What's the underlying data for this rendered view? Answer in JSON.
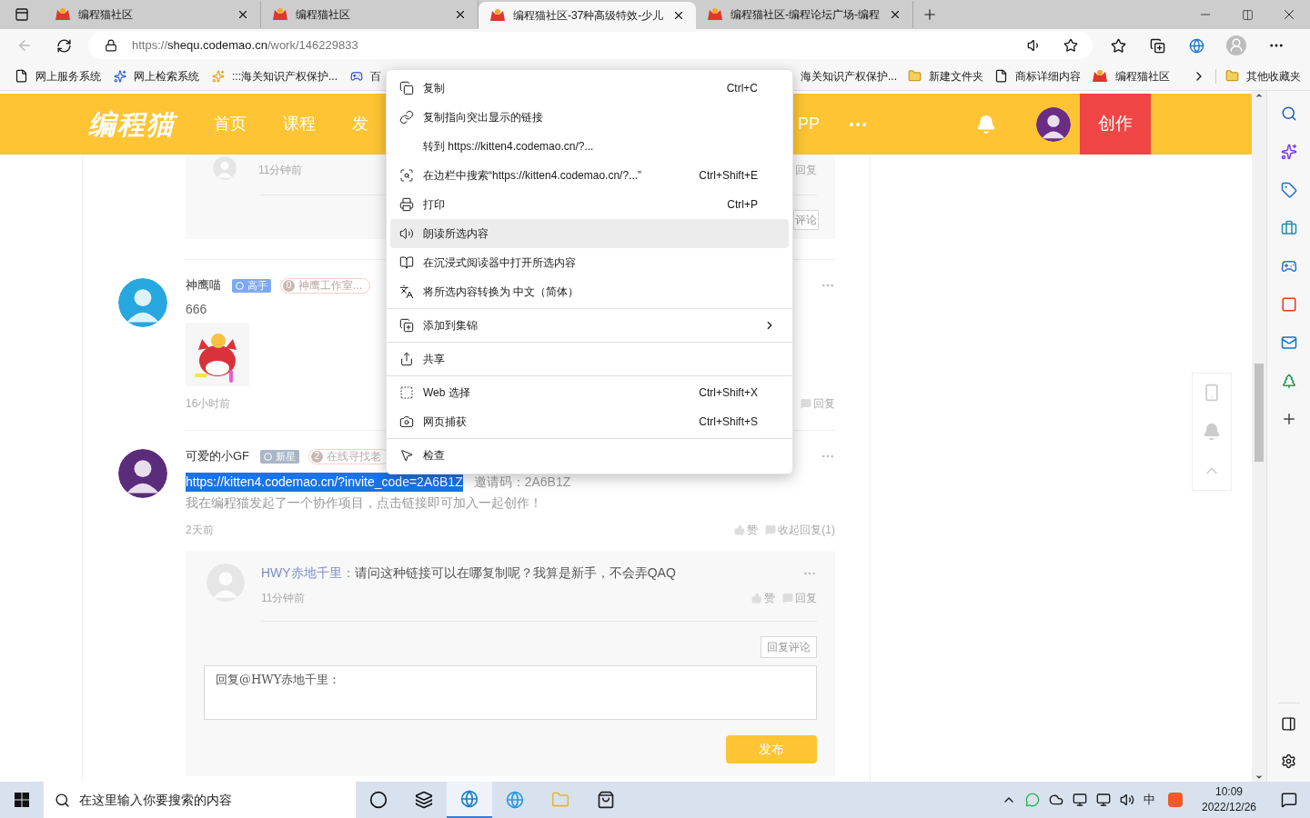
{
  "browser": {
    "tabs": [
      {
        "title": "编程猫社区",
        "selected": false
      },
      {
        "title": "编程猫社区",
        "selected": false
      },
      {
        "title": "编程猫社区-37种高级特效-少儿",
        "selected": true
      },
      {
        "title": "编程猫社区-编程论坛广场-编程",
        "selected": false
      }
    ],
    "url": {
      "scheme": "https://",
      "host": "shequ.codemao.cn",
      "path": "/work/146229833"
    },
    "bookmarks_left": [
      {
        "label": "网上服务系统"
      },
      {
        "label": "网上检索系统"
      },
      {
        "label": ":::海关知识产权保护..."
      },
      {
        "label": "百"
      }
    ],
    "bookmarks_right": [
      {
        "label": "海关知识产权保护..."
      },
      {
        "label": "新建文件夹"
      },
      {
        "label": "商标详细内容"
      },
      {
        "label": "编程猫社区"
      }
    ],
    "other_bookmarks": "其他收藏夹"
  },
  "site_header": {
    "logo": "编程猫",
    "nav": [
      {
        "label": "首页"
      },
      {
        "label": "课程"
      },
      {
        "label": "发"
      },
      {
        "label": "PP"
      }
    ],
    "create_button": "创作"
  },
  "top_reply": {
    "time": "11分钟前",
    "reply": "回复",
    "comment_button": "评论"
  },
  "comments": [
    {
      "author": "神鹰喵",
      "badges": [
        {
          "kind": "level",
          "label": "高手",
          "color": "#7ea9f2"
        },
        {
          "kind": "studio",
          "count": "0",
          "label": "神鹰工作室..."
        }
      ],
      "content": "666",
      "attachment": {
        "kind": "picture"
      },
      "time": "16小时前",
      "actions": [
        {
          "kind": "reply",
          "label": "回复"
        }
      ]
    },
    {
      "author": "可爱的小GF",
      "badges": [
        {
          "kind": "level",
          "label": "新星",
          "color": "#a9b6c6"
        },
        {
          "kind": "studio",
          "count": "2",
          "label": "在线寻找老"
        }
      ],
      "link": {
        "text": "https://kitten4.codemao.cn/?invite_code=2A6B1Z",
        "selected": true
      },
      "invite": "邀请码：2A6B1Z",
      "content": "我在编程猫发起了一个协作项目，点击链接即可加入一起创作！",
      "time": "2天前",
      "actions": [
        {
          "kind": "like",
          "label": "赞"
        },
        {
          "kind": "collapse",
          "label": "收起回复(1)"
        }
      ],
      "reply": {
        "author": "HWY赤地千里：",
        "text": "请问这种链接可以在哪复制呢？我算是新手，不会弄QAQ",
        "time": "11分钟前",
        "actions": [
          {
            "kind": "like",
            "label": "赞"
          },
          {
            "kind": "reply",
            "label": "回复"
          }
        ],
        "comment_button": "回复评论",
        "input_placeholder": "回复@HWY赤地千里：",
        "submit": "发布"
      }
    }
  ],
  "context_menu": [
    {
      "kind": "item",
      "label": "复制",
      "shortcut": "Ctrl+C",
      "selected": false
    },
    {
      "kind": "item",
      "label": "复制指向突出显示的链接",
      "selected": false
    },
    {
      "kind": "item",
      "label": "转到 https://kitten4.codemao.cn/?...",
      "selected": false
    },
    {
      "kind": "item",
      "label": "在边栏中搜索“https://kitten4.codemao.cn/?...”",
      "shortcut": "Ctrl+Shift+E",
      "selected": false
    },
    {
      "kind": "item",
      "label": "打印",
      "shortcut": "Ctrl+P",
      "selected": false
    },
    {
      "kind": "item",
      "label": "朗读所选内容",
      "selected": true
    },
    {
      "kind": "item",
      "label": "在沉浸式阅读器中打开所选内容",
      "selected": false
    },
    {
      "kind": "item",
      "label": "将所选内容转换为 中文（简体）",
      "selected": false
    },
    {
      "kind": "separator"
    },
    {
      "kind": "item",
      "label": "添加到集锦",
      "selected": false,
      "submenu": true
    },
    {
      "kind": "separator"
    },
    {
      "kind": "item",
      "label": "共享",
      "selected": false
    },
    {
      "kind": "separator"
    },
    {
      "kind": "item",
      "label": "Web 选择",
      "shortcut": "Ctrl+Shift+X",
      "selected": false
    },
    {
      "kind": "item",
      "label": "网页捕获",
      "shortcut": "Ctrl+Shift+S",
      "selected": false
    },
    {
      "kind": "separator"
    },
    {
      "kind": "item",
      "label": "检查",
      "selected": false
    }
  ],
  "taskbar": {
    "search_placeholder": "在这里输入你要搜索的内容",
    "apps": [
      {
        "selected": false
      },
      {
        "selected": false
      },
      {
        "selected": true
      },
      {
        "selected": false
      },
      {
        "selected": false
      },
      {
        "selected": false
      }
    ],
    "ime": "中",
    "time": "10:09",
    "date": "2022/12/26"
  }
}
